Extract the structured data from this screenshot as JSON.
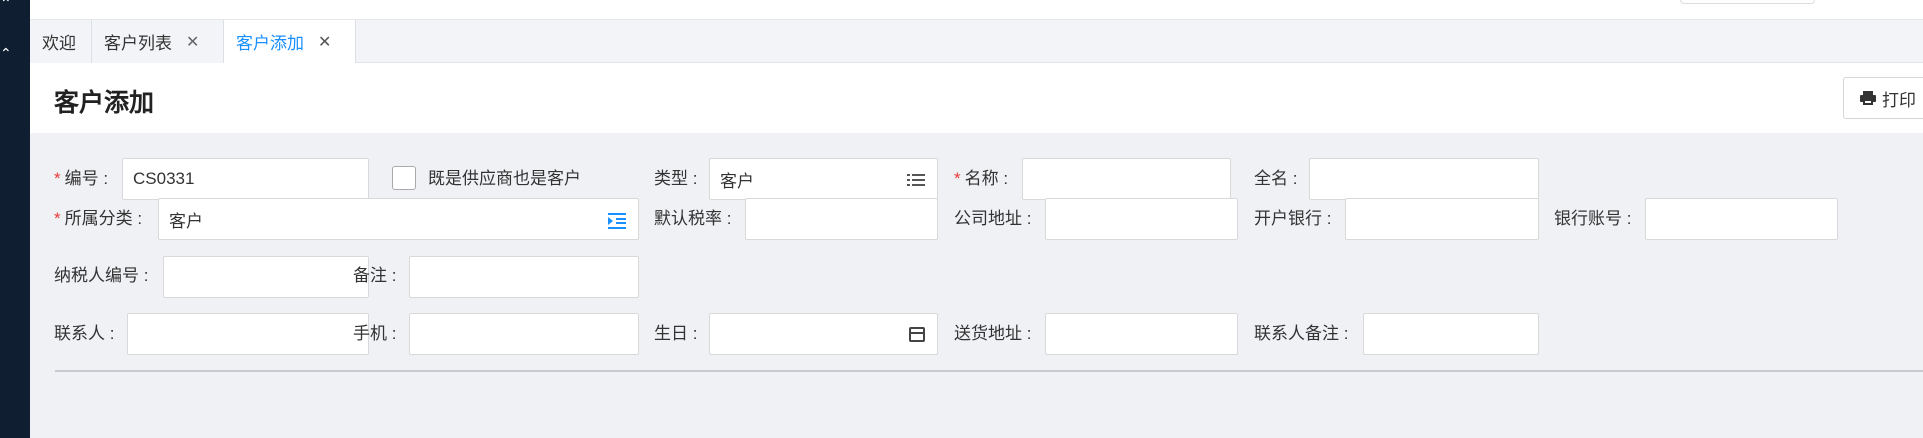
{
  "tabs": [
    {
      "label": "欢迎",
      "closable": false,
      "active": false
    },
    {
      "label": "客户列表",
      "closable": true,
      "active": false
    },
    {
      "label": "客户添加",
      "closable": true,
      "active": true
    }
  ],
  "header": {
    "title": "客户添加",
    "print_label": "打印"
  },
  "form": {
    "code": {
      "label": "编号",
      "required": true,
      "value": "CS0331"
    },
    "both_supplier": {
      "label": "既是供应商也是客户",
      "checked": false
    },
    "type": {
      "label": "类型",
      "value": "客户"
    },
    "name": {
      "label": "名称",
      "required": true,
      "value": ""
    },
    "full_name": {
      "label": "全名",
      "value": ""
    },
    "category": {
      "label": "所属分类",
      "required": true,
      "value": "客户"
    },
    "tax_rate": {
      "label": "默认税率",
      "value": ""
    },
    "company_address": {
      "label": "公司地址",
      "value": ""
    },
    "bank": {
      "label": "开户银行",
      "value": ""
    },
    "bank_account": {
      "label": "银行账号",
      "value": ""
    },
    "taxpayer_id": {
      "label": "纳税人编号",
      "value": ""
    },
    "remark": {
      "label": "备注",
      "value": ""
    },
    "contact": {
      "label": "联系人",
      "value": ""
    },
    "mobile": {
      "label": "手机",
      "value": ""
    },
    "birthday": {
      "label": "生日",
      "value": ""
    },
    "delivery_address": {
      "label": "送货地址",
      "value": ""
    },
    "contact_remark": {
      "label": "联系人备注",
      "value": ""
    }
  },
  "colors": {
    "accent": "#1890ff",
    "required": "#e53935",
    "sidebar": "#0f1e31"
  }
}
